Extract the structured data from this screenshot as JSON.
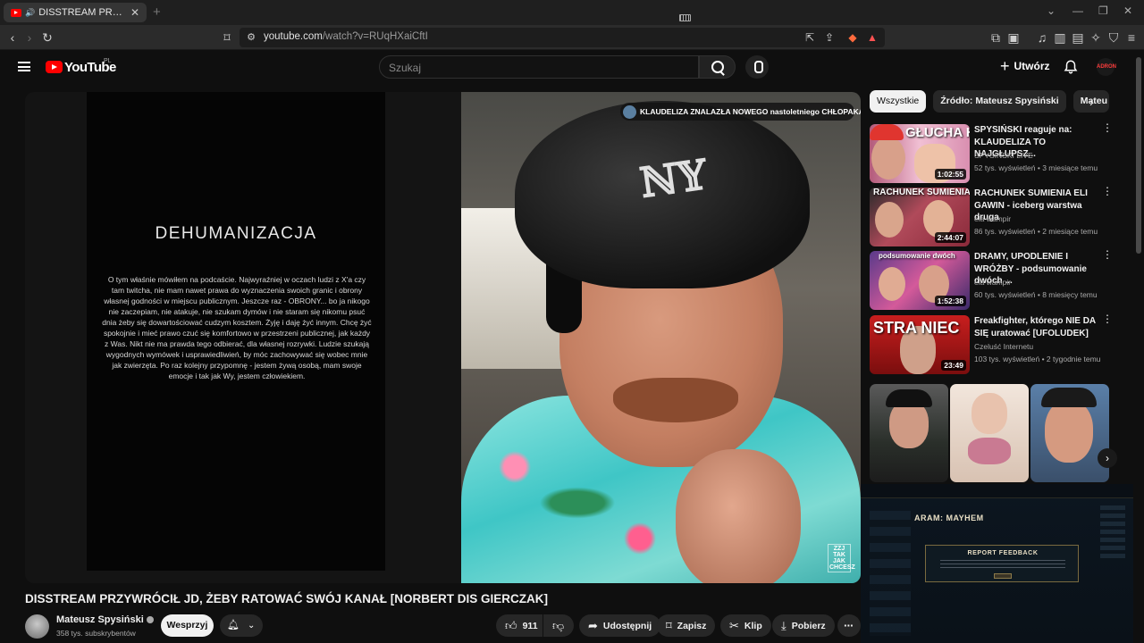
{
  "browser": {
    "tab_title": "DISSTREAM PRZYWRÓCIŁ JD",
    "url_host": "youtube.com",
    "url_path": "/watch?v=RUqHXaiCftI"
  },
  "header": {
    "logo_text": "YouTube",
    "country_code": "PL",
    "search_placeholder": "Szukaj",
    "create_label": "Utwórz",
    "avatar_text": "ADRON"
  },
  "player": {
    "panel_heading": "DEHUMANIZACJA",
    "panel_body": "O tym właśnie mówiłem na podcaście. Najwyraźniej w oczach ludzi z X'a czy tam twitcha, nie mam nawet prawa do wyznaczenia swoich granic i obrony własnej godności w miejscu publicznym. Jeszcze raz - OBRONY... bo ja nikogo nie zaczepiam, nie atakuje, nie szukam dymów i nie staram się nikomu psuć dnia żeby się dowartościować cudzym kosztem. Żyję i daję żyć innym. Chcę żyć spokojnie i mieć prawo czuć się komfortowo w przestrzeni publicznej, jak każdy z Was. Nikt nie ma prawda tego odbierać, dla własnej rozrywki. Ludzie szukają wygodnych wymówek i usprawiedliwień, by móc zachowywać się wobec mnie jak zwierzęta. Po raz kolejny przypomnę - jestem żywą osobą, mam swoje emocje i tak jak Wy, jestem człowiekiem.",
    "notification": "KLAUDELIZA ZNALAZŁA NOWEGO nastoletniego CHŁOPAKA!",
    "watermark": "ZZJ TAK JAK CHCESZ"
  },
  "video": {
    "title": "DISSTREAM PRZYWRÓCIŁ JD, ŻEBY RATOWAĆ SWÓJ KANAŁ [NORBERT DIS GIERCZAK]",
    "channel_name": "Mateusz Spysiński",
    "subscribers": "358 tys. subskrybentów",
    "support_label": "Wesprzyj",
    "likes": "911",
    "share_label": "Udostępnij",
    "save_label": "Zapisz",
    "clip_label": "Klip",
    "download_label": "Pobierz"
  },
  "sidebar": {
    "chips": [
      "Wszystkie",
      "Źródło: Mateusz Spysiński",
      "Mateu"
    ],
    "recommendations": [
      {
        "thumb_text": "GŁUCHA KLAUDIA",
        "duration": "1:02:55",
        "title": "SPYSIŃSKI reaguje na: KLAUDELIZA TO NAJGŁUPSZ...",
        "channel": "SPYSIŃSKI LIVE",
        "meta": "52 tys. wyświetleń • 3 miesiące temu"
      },
      {
        "thumb_text": "RACHUNEK SUMIENIA",
        "duration": "2:44:07",
        "title": "RACHUNEK SUMIENIA ELI GAWIN - iceberg warstwa druga",
        "channel": "ela wampir",
        "meta": "86 tys. wyświetleń • 2 miesiące temu"
      },
      {
        "thumb_text": "podsumowanie dwóch",
        "duration": "1:52:38",
        "title": "DRAMY, UPODLENIE I WRÓŻBY - podsumowanie dwóch ...",
        "channel": "ela wampir",
        "meta": "60 tys. wyświetleń • 8 miesięcy temu"
      },
      {
        "thumb_text": "STRA NIEC",
        "duration": "23:49",
        "title": "Freakfighter, którego NIE DA SIĘ uratować [UFOLUDEK]",
        "channel": "Czeluść Internetu",
        "meta": "103 tys. wyświetleń • 2 tygodnie temu"
      }
    ]
  },
  "game": {
    "mode_label": "ARAM: MAYHEM",
    "dialog_title": "REPORT FEEDBACK"
  },
  "colors": {
    "brand": "#ff0000",
    "background": "#0f0f0f",
    "chip": "#272727"
  }
}
